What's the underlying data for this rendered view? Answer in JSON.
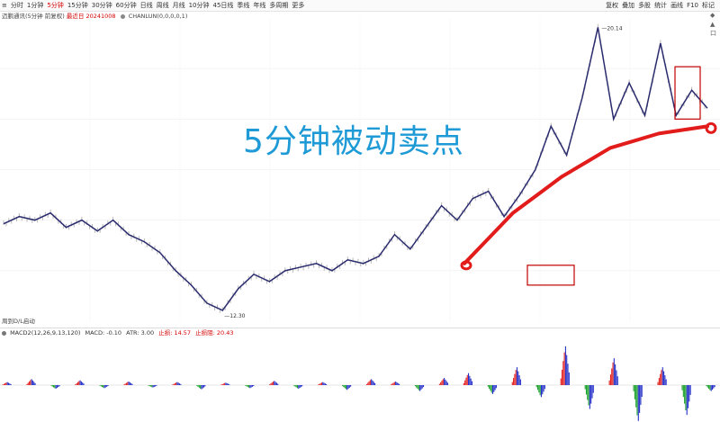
{
  "toolbar": {
    "periods": [
      "分时",
      "1分钟",
      "5分钟",
      "15分钟",
      "30分钟",
      "60分钟",
      "日线",
      "周线",
      "月线",
      "10分钟",
      "45日线",
      "季线",
      "年线",
      "多周期",
      "更多"
    ],
    "active_index": 2,
    "tools": [
      "复权",
      "叠加",
      "多股",
      "统计",
      "画线",
      "F10",
      "标记"
    ],
    "top_left_marker": "≡"
  },
  "info": {
    "stock": "迈鹏通讯(5分钟 前复权)",
    "date_label": "最近日",
    "date": "20241008",
    "indicator": "CHANLUN(0,0,0,0,1)"
  },
  "side": {
    "icons": [
      "◆",
      "▲",
      "口"
    ]
  },
  "overlay_title": "5分钟被动卖点",
  "price_labels": {
    "high": "20.14",
    "low": "12.30"
  },
  "sub_label": "周到D/L启动",
  "macd": {
    "title": "MACD2(12,26,9,13,120)",
    "fields": [
      {
        "label": "MACD",
        "value": "-0.10"
      },
      {
        "label": "ATR",
        "value": "3.00"
      },
      {
        "label": "止损",
        "value": "14.57"
      },
      {
        "label": "止损阻",
        "value": "20.43"
      }
    ]
  },
  "chart_data": {
    "type": "line",
    "series": [
      {
        "values": [
          14.7,
          14.9,
          14.8,
          15.0,
          14.6,
          14.8,
          14.5,
          14.8,
          14.4,
          14.2,
          13.9,
          13.4,
          13.0,
          12.5,
          12.3,
          12.9,
          13.3,
          13.1,
          13.4,
          13.5,
          13.6,
          13.4,
          13.7,
          13.6,
          13.8,
          14.4,
          14.0,
          14.6,
          15.2,
          14.8,
          15.4,
          15.6,
          14.9,
          15.5,
          16.2,
          17.4,
          16.6,
          18.2,
          20.14,
          17.6,
          18.6,
          17.7,
          19.7,
          17.7,
          18.4,
          17.9
        ]
      },
      {
        "values": [
          13.6,
          14.3,
          15.0,
          15.5,
          16.0,
          16.4,
          16.8,
          17.0,
          17.2,
          17.3,
          17.4
        ]
      },
      {
        "values": [
          0.05,
          0.1,
          -0.06,
          0.08,
          -0.05,
          0.06,
          -0.04,
          0.05,
          -0.07,
          0.04,
          -0.05,
          0.07,
          -0.06,
          0.05,
          -0.08,
          0.1,
          0.06,
          -0.1,
          0.12,
          0.2,
          -0.15,
          0.3,
          -0.2,
          0.65,
          -0.4,
          0.45,
          -0.6,
          0.3,
          -0.5,
          -0.1
        ]
      }
    ],
    "grid": true,
    "highlight_boxes": 2,
    "ylim": [
      12.0,
      20.4
    ],
    "macd_ylim": [
      -0.7,
      0.7
    ]
  }
}
